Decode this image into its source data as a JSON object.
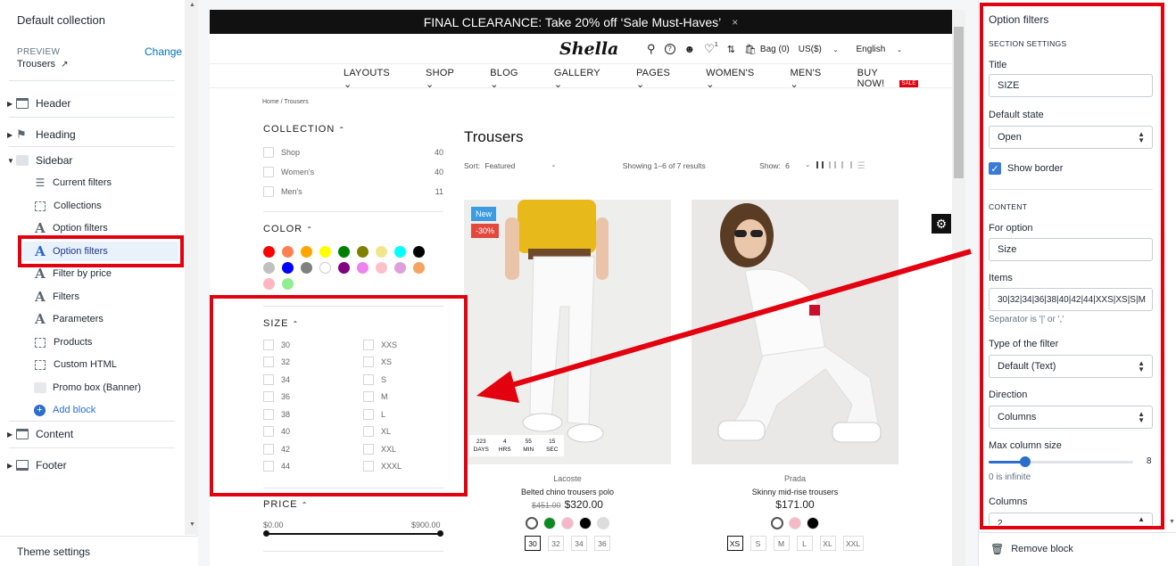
{
  "left_panel": {
    "title": "Default collection",
    "preview_label": "PREVIEW",
    "preview_value": "Trousers",
    "change_label": "Change",
    "sections": {
      "header": "Header",
      "heading": "Heading",
      "sidebar": "Sidebar",
      "content": "Content",
      "footer": "Footer"
    },
    "sidebar_blocks": [
      {
        "label": "Current filters",
        "icon": "lines-icon"
      },
      {
        "label": "Collections",
        "icon": "dashed-box-icon"
      },
      {
        "label": "Option filters",
        "icon": "text-a-icon"
      },
      {
        "label": "Option filters",
        "icon": "text-a-icon",
        "selected": true
      },
      {
        "label": "Filter by price",
        "icon": "text-a-icon"
      },
      {
        "label": "Filters",
        "icon": "text-a-icon"
      },
      {
        "label": "Parameters",
        "icon": "text-a-icon"
      },
      {
        "label": "Products",
        "icon": "dashed-box-icon"
      },
      {
        "label": "Custom HTML",
        "icon": "dashed-box-icon"
      },
      {
        "label": "Promo box (Banner)",
        "icon": "image-icon"
      }
    ],
    "add_block": "Add block",
    "theme_settings": "Theme settings"
  },
  "store": {
    "banner": "FINAL CLEARANCE: Take 20% off ‘Sale Must-Haves’",
    "banner_close": "×",
    "logo": "Shella",
    "header": {
      "wishlist_count": "1",
      "bag": "Bag (0)",
      "currency": "US($)",
      "language": "English"
    },
    "nav": [
      "LAYOUTS",
      "SHOP",
      "BLOG",
      "GALLERY",
      "PAGES",
      "WOMEN'S",
      "MEN'S"
    ],
    "nav_buy": "BUY NOW!",
    "nav_sale_tag": "SALE",
    "breadcrumb": "Home  /  Trousers",
    "sidebar": {
      "collection_title": "COLLECTION",
      "collection_items": [
        {
          "label": "Shop",
          "count": "40"
        },
        {
          "label": "Women's",
          "count": "40"
        },
        {
          "label": "Men's",
          "count": "11"
        }
      ],
      "color_title": "COLOR",
      "colors": [
        "#ff0000",
        "#ff7f50",
        "#ffa500",
        "#ffff00",
        "#008000",
        "#808000",
        "#f0e68c",
        "#00ffff",
        "#000000",
        "#c0c0c0",
        "#0000ff",
        "#808080",
        "#ffffff",
        "#800080",
        "#ee82ee",
        "#ffc0cb",
        "#dda0dd",
        "#f4a460",
        "#ffb6c1",
        "#90ee90"
      ],
      "size_title": "SIZE",
      "sizes_col1": [
        "30",
        "32",
        "34",
        "36",
        "38",
        "40",
        "42",
        "44"
      ],
      "sizes_col2": [
        "XXS",
        "XS",
        "S",
        "M",
        "L",
        "XL",
        "XXL",
        "XXXL"
      ],
      "price_title": "PRICE",
      "price_min": "$0.00",
      "price_max": "$900.00"
    },
    "page_title": "Trousers",
    "sort_label": "Sort:",
    "sort_value": "Featured",
    "showing": "Showing 1–6 of 7 results",
    "show_label": "Show:",
    "show_value": "6",
    "products": [
      {
        "badge_new": "New",
        "badge_sale": "-30%",
        "brand": "Lacoste",
        "name": "Belted chino trousers polo",
        "old_price": "$451.00",
        "price": "$320.00",
        "colors": [
          "#ffffff",
          "#0a8a1f",
          "#f6b8c6",
          "#000000",
          "#dddddd"
        ],
        "sizes": [
          "30",
          "32",
          "34",
          "36"
        ],
        "countdown": [
          {
            "value": "223",
            "unit": "DAYS"
          },
          {
            "value": "4",
            "unit": "HRS"
          },
          {
            "value": "55",
            "unit": "MIN"
          },
          {
            "value": "15",
            "unit": "SEC"
          }
        ]
      },
      {
        "brand": "Prada",
        "name": "Skinny mid-rise trousers",
        "price": "$171.00",
        "colors": [
          "#ffffff",
          "#f6b8c6",
          "#000000"
        ],
        "sizes": [
          "XS",
          "S",
          "M",
          "L",
          "XL",
          "XXL"
        ]
      }
    ]
  },
  "right_panel": {
    "title": "Option filters",
    "section_settings": "SECTION SETTINGS",
    "title_label": "Title",
    "title_value": "SIZE",
    "default_state_label": "Default state",
    "default_state_value": "Open",
    "show_border_label": "Show border",
    "content_caption": "CONTENT",
    "for_option_label": "For option",
    "for_option_value": "Size",
    "items_label": "Items",
    "items_value": "30|32|34|36|38|40|42|44|XXS|XS|S|M",
    "separator_hint": "Separator is '|' or ','",
    "filter_type_label": "Type of the filter",
    "filter_type_value": "Default (Text)",
    "direction_label": "Direction",
    "direction_value": "Columns",
    "max_col_label": "Max column size",
    "max_col_value": "8",
    "max_col_fraction": 0.25,
    "infinite_hint": "0 is infinite",
    "columns_label": "Columns",
    "columns_value": "2",
    "remove_block": "Remove block"
  },
  "colors": {
    "highlight": "#e3000f",
    "link": "#006fbb",
    "accent": "#3a7bd5"
  }
}
